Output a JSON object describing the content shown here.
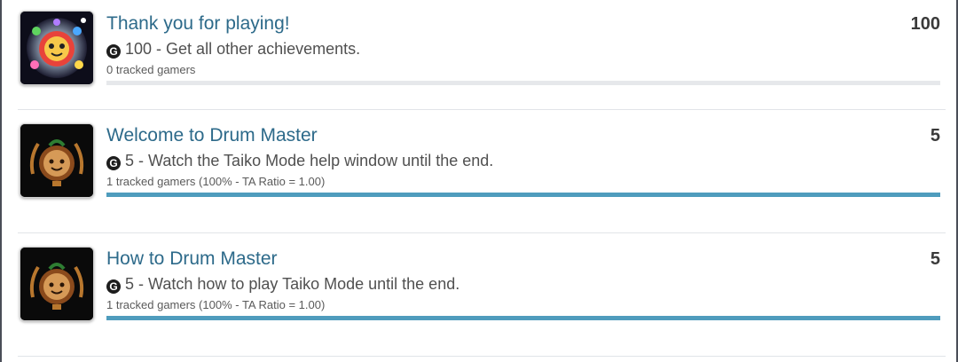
{
  "achievements": [
    {
      "title": "Thank you for playing!",
      "score": "100",
      "gamerscore": "100",
      "description": "Get all other achievements.",
      "tracked": "0 tracked gamers",
      "progress": 0,
      "icon": "rainbow-drum-badge-icon"
    },
    {
      "title": "Welcome to Drum Master",
      "score": "5",
      "gamerscore": "5",
      "description": "Watch the Taiko Mode help window until the end.",
      "tracked": "1 tracked gamers (100% - TA Ratio = 1.00)",
      "progress": 1.0,
      "icon": "bronze-drum-badge-icon"
    },
    {
      "title": "How to Drum Master",
      "score": "5",
      "gamerscore": "5",
      "description": "Watch how to play Taiko Mode until the end.",
      "tracked": "1 tracked gamers (100% - TA Ratio = 1.00)",
      "progress": 1.0,
      "icon": "bronze-drum-badge-icon"
    }
  ],
  "gamerscore_glyph": "G",
  "colors": {
    "title": "#2d6a8a",
    "progress": "#4f9cbd",
    "track": "#e6e8eb"
  }
}
